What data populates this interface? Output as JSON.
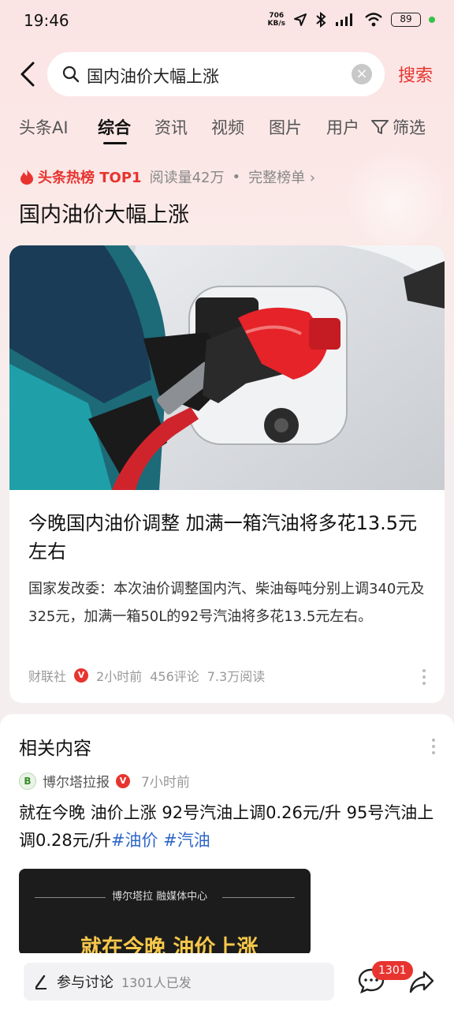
{
  "status_bar": {
    "time": "19:46",
    "net_speed_value": "706",
    "net_speed_unit": "KB/s",
    "battery": "89",
    "icons": [
      "location-icon",
      "bluetooth-icon",
      "hd-signal-icon",
      "wifi-icon",
      "battery-icon"
    ]
  },
  "search": {
    "query": "国内油价大幅上涨",
    "button_label": "搜索"
  },
  "tabs": [
    {
      "label": "头条AI"
    },
    {
      "label": "综合",
      "active": true
    },
    {
      "label": "资讯"
    },
    {
      "label": "视频"
    },
    {
      "label": "图片"
    },
    {
      "label": "用户"
    }
  ],
  "filter_label": "筛选",
  "hot": {
    "badge": "头条热榜 TOP1",
    "reads": "阅读量42万",
    "separator": "•",
    "full_list": "完整榜单 ›"
  },
  "page_title": "国内油价大幅上涨",
  "article": {
    "title": "今晚国内油价调整 加满一箱汽油将多花13.5元左右",
    "summary": "国家发改委：本次油价调整国内汽、柴油每吨分别上调340元及325元，加满一箱50L的92号汽油将多花13.5元左右。",
    "source": "财联社",
    "verified": "V",
    "time": "2小时前",
    "comments": "456评论",
    "reads": "7.3万阅读"
  },
  "related": {
    "heading": "相关内容",
    "author": "博尔塔拉报",
    "verified": "V",
    "time": "7小时前",
    "text_main": "就在今晚 油价上涨 92号汽油上调0.26元/升 95号汽油上调0.28元/升",
    "tags": [
      "#油价",
      "#汽油"
    ],
    "video": {
      "brand": "博尔塔拉 融媒体中心",
      "headline": "就在今晚 油价上涨"
    }
  },
  "bottom": {
    "discuss_label": "参与讨论",
    "discuss_count": "1301人已发",
    "comment_badge": "1301"
  },
  "colors": {
    "accent_red": "#e8342f",
    "tag_blue": "#2e66c9"
  }
}
